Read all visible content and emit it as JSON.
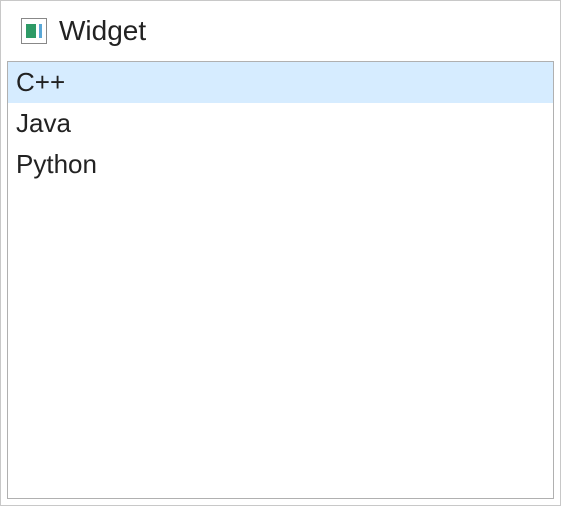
{
  "window": {
    "title": "Widget"
  },
  "list": {
    "items": [
      {
        "label": "C++",
        "selected": true
      },
      {
        "label": "Java",
        "selected": false
      },
      {
        "label": "Python",
        "selected": false
      }
    ]
  }
}
